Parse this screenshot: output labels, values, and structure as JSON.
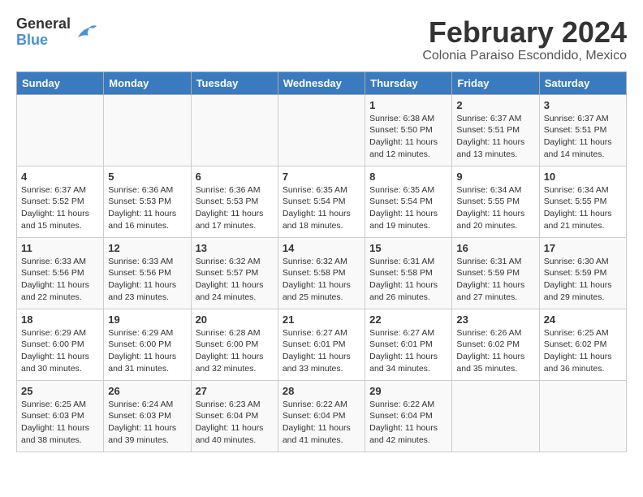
{
  "logo": {
    "general": "General",
    "blue": "Blue"
  },
  "title": "February 2024",
  "subtitle": "Colonia Paraiso Escondido, Mexico",
  "days_of_week": [
    "Sunday",
    "Monday",
    "Tuesday",
    "Wednesday",
    "Thursday",
    "Friday",
    "Saturday"
  ],
  "weeks": [
    [
      {
        "day": "",
        "info": ""
      },
      {
        "day": "",
        "info": ""
      },
      {
        "day": "",
        "info": ""
      },
      {
        "day": "",
        "info": ""
      },
      {
        "day": "1",
        "info": "Sunrise: 6:38 AM\nSunset: 5:50 PM\nDaylight: 11 hours\nand 12 minutes."
      },
      {
        "day": "2",
        "info": "Sunrise: 6:37 AM\nSunset: 5:51 PM\nDaylight: 11 hours\nand 13 minutes."
      },
      {
        "day": "3",
        "info": "Sunrise: 6:37 AM\nSunset: 5:51 PM\nDaylight: 11 hours\nand 14 minutes."
      }
    ],
    [
      {
        "day": "4",
        "info": "Sunrise: 6:37 AM\nSunset: 5:52 PM\nDaylight: 11 hours\nand 15 minutes."
      },
      {
        "day": "5",
        "info": "Sunrise: 6:36 AM\nSunset: 5:53 PM\nDaylight: 11 hours\nand 16 minutes."
      },
      {
        "day": "6",
        "info": "Sunrise: 6:36 AM\nSunset: 5:53 PM\nDaylight: 11 hours\nand 17 minutes."
      },
      {
        "day": "7",
        "info": "Sunrise: 6:35 AM\nSunset: 5:54 PM\nDaylight: 11 hours\nand 18 minutes."
      },
      {
        "day": "8",
        "info": "Sunrise: 6:35 AM\nSunset: 5:54 PM\nDaylight: 11 hours\nand 19 minutes."
      },
      {
        "day": "9",
        "info": "Sunrise: 6:34 AM\nSunset: 5:55 PM\nDaylight: 11 hours\nand 20 minutes."
      },
      {
        "day": "10",
        "info": "Sunrise: 6:34 AM\nSunset: 5:55 PM\nDaylight: 11 hours\nand 21 minutes."
      }
    ],
    [
      {
        "day": "11",
        "info": "Sunrise: 6:33 AM\nSunset: 5:56 PM\nDaylight: 11 hours\nand 22 minutes."
      },
      {
        "day": "12",
        "info": "Sunrise: 6:33 AM\nSunset: 5:56 PM\nDaylight: 11 hours\nand 23 minutes."
      },
      {
        "day": "13",
        "info": "Sunrise: 6:32 AM\nSunset: 5:57 PM\nDaylight: 11 hours\nand 24 minutes."
      },
      {
        "day": "14",
        "info": "Sunrise: 6:32 AM\nSunset: 5:58 PM\nDaylight: 11 hours\nand 25 minutes."
      },
      {
        "day": "15",
        "info": "Sunrise: 6:31 AM\nSunset: 5:58 PM\nDaylight: 11 hours\nand 26 minutes."
      },
      {
        "day": "16",
        "info": "Sunrise: 6:31 AM\nSunset: 5:59 PM\nDaylight: 11 hours\nand 27 minutes."
      },
      {
        "day": "17",
        "info": "Sunrise: 6:30 AM\nSunset: 5:59 PM\nDaylight: 11 hours\nand 29 minutes."
      }
    ],
    [
      {
        "day": "18",
        "info": "Sunrise: 6:29 AM\nSunset: 6:00 PM\nDaylight: 11 hours\nand 30 minutes."
      },
      {
        "day": "19",
        "info": "Sunrise: 6:29 AM\nSunset: 6:00 PM\nDaylight: 11 hours\nand 31 minutes."
      },
      {
        "day": "20",
        "info": "Sunrise: 6:28 AM\nSunset: 6:00 PM\nDaylight: 11 hours\nand 32 minutes."
      },
      {
        "day": "21",
        "info": "Sunrise: 6:27 AM\nSunset: 6:01 PM\nDaylight: 11 hours\nand 33 minutes."
      },
      {
        "day": "22",
        "info": "Sunrise: 6:27 AM\nSunset: 6:01 PM\nDaylight: 11 hours\nand 34 minutes."
      },
      {
        "day": "23",
        "info": "Sunrise: 6:26 AM\nSunset: 6:02 PM\nDaylight: 11 hours\nand 35 minutes."
      },
      {
        "day": "24",
        "info": "Sunrise: 6:25 AM\nSunset: 6:02 PM\nDaylight: 11 hours\nand 36 minutes."
      }
    ],
    [
      {
        "day": "25",
        "info": "Sunrise: 6:25 AM\nSunset: 6:03 PM\nDaylight: 11 hours\nand 38 minutes."
      },
      {
        "day": "26",
        "info": "Sunrise: 6:24 AM\nSunset: 6:03 PM\nDaylight: 11 hours\nand 39 minutes."
      },
      {
        "day": "27",
        "info": "Sunrise: 6:23 AM\nSunset: 6:04 PM\nDaylight: 11 hours\nand 40 minutes."
      },
      {
        "day": "28",
        "info": "Sunrise: 6:22 AM\nSunset: 6:04 PM\nDaylight: 11 hours\nand 41 minutes."
      },
      {
        "day": "29",
        "info": "Sunrise: 6:22 AM\nSunset: 6:04 PM\nDaylight: 11 hours\nand 42 minutes."
      },
      {
        "day": "",
        "info": ""
      },
      {
        "day": "",
        "info": ""
      }
    ]
  ]
}
